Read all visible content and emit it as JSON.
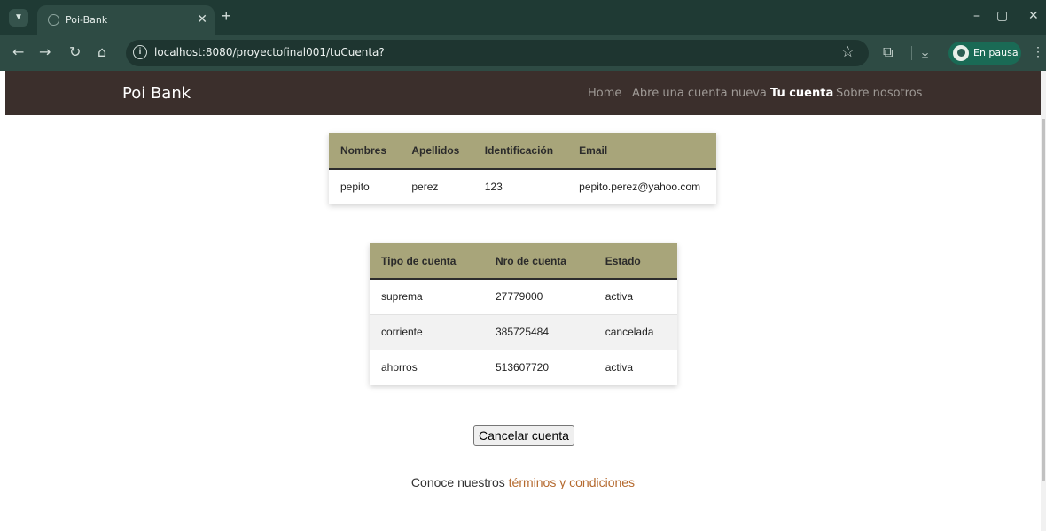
{
  "browser": {
    "tab_title": "Poi-Bank",
    "url": "localhost:8080/proyectofinal001/tuCuenta?",
    "profile_label": "En pausa"
  },
  "navbar": {
    "brand": "Poi Bank",
    "links": [
      {
        "label": "Home",
        "active": false
      },
      {
        "label": "Abre una cuenta nueva",
        "active": false
      },
      {
        "label": "Tu cuenta",
        "active": true
      },
      {
        "label": "Sobre nosotros",
        "active": false
      }
    ]
  },
  "user_table": {
    "headers": [
      "Nombres",
      "Apellidos",
      "Identificación",
      "Email"
    ],
    "rows": [
      [
        "pepito",
        "perez",
        "123",
        "pepito.perez@yahoo.com"
      ]
    ]
  },
  "accounts_table": {
    "headers": [
      "Tipo de cuenta",
      "Nro de cuenta",
      "Estado"
    ],
    "rows": [
      [
        "suprema",
        "27779000",
        "activa"
      ],
      [
        "corriente",
        "385725484",
        "cancelada"
      ],
      [
        "ahorros",
        "513607720",
        "activa"
      ]
    ]
  },
  "cancel_button": "Cancelar cuenta",
  "footer": {
    "text": "Conoce nuestros ",
    "link": "términos y condiciones"
  },
  "colors": {
    "navbar_bg": "#3b2f2c",
    "table_header_bg": "#a8a57a",
    "link": "#b4692e",
    "browser_frame": "#1f3a34"
  }
}
